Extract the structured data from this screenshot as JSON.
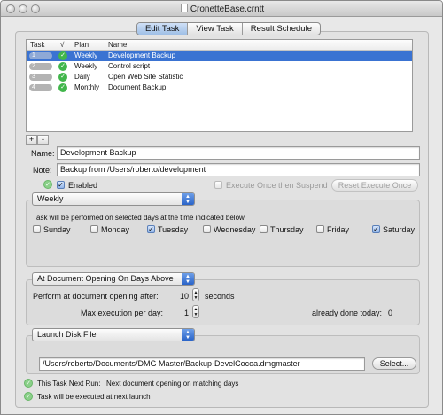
{
  "window": {
    "title": "CronetteBase.crntt"
  },
  "tabs": [
    {
      "label": "Edit Task",
      "active": true
    },
    {
      "label": "View Task",
      "active": false
    },
    {
      "label": "Result Schedule",
      "active": false
    }
  ],
  "task_table": {
    "headers": {
      "task": "Task",
      "check": "√",
      "plan": "Plan",
      "name": "Name"
    },
    "rows": [
      {
        "index": "1",
        "plan": "Weekly",
        "name": "Development Backup",
        "selected": true
      },
      {
        "index": "2",
        "plan": "Weekly",
        "name": "Control script",
        "selected": false
      },
      {
        "index": "3",
        "plan": "Daily",
        "name": "Open Web Site Statistic",
        "selected": false
      },
      {
        "index": "4",
        "plan": "Monthly",
        "name": "Document Backup",
        "selected": false
      }
    ]
  },
  "list_buttons": {
    "add": "+",
    "remove": "-"
  },
  "form": {
    "name_label": "Name:",
    "name_value": "Development Backup",
    "note_label": "Note:",
    "note_value": "Backup from /Users/roberto/development",
    "enabled_label": "Enabled",
    "execute_once_label": "Execute Once then Suspend",
    "reset_button": "Reset Execute Once"
  },
  "schedule": {
    "plan_value": "Weekly",
    "description": "Task will be performed on selected days at the time indicated below",
    "days": [
      {
        "label": "Sunday",
        "checked": false
      },
      {
        "label": "Monday",
        "checked": false
      },
      {
        "label": "Tuesday",
        "checked": true
      },
      {
        "label": "Wednesday",
        "checked": false
      },
      {
        "label": "Thursday",
        "checked": false
      },
      {
        "label": "Friday",
        "checked": false
      },
      {
        "label": "Saturday",
        "checked": true
      }
    ]
  },
  "trigger": {
    "mode_value": "At Document Opening On Days Above",
    "perform_label": "Perform at document opening after:",
    "perform_value": "10",
    "perform_unit": "seconds",
    "max_label": "Max execution per day:",
    "max_value": "1",
    "done_label": "already done today:",
    "done_value": "0"
  },
  "action": {
    "type_value": "Launch Disk File",
    "path_value": "/Users/roberto/Documents/DMG Master/Backup-DevelCocoa.dmgmaster",
    "select_button": "Select..."
  },
  "status": {
    "next_run_label": "This Task Next Run:",
    "next_run_value": "Next document opening on matching days",
    "launch_note": "Task will be executed at next launch"
  },
  "colors": {
    "selection": "#3a73d2",
    "status_green": "#41b64b",
    "popup_blue": "#2a64c8"
  }
}
